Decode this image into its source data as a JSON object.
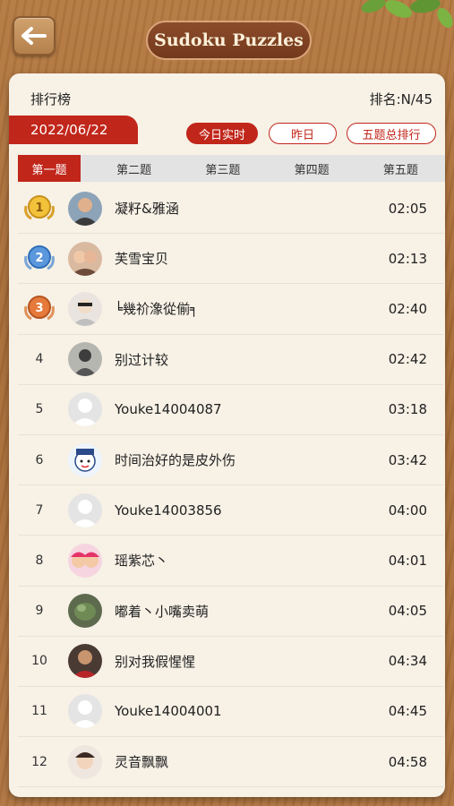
{
  "header": {
    "title": "Sudoku Puzzles"
  },
  "panel": {
    "board_title": "排行榜",
    "rank_info": "排名:N/45",
    "date": "2022/06/22",
    "filters": [
      "今日实时",
      "昨日",
      "五题总排行"
    ],
    "tabs": [
      "第一题",
      "第二题",
      "第三题",
      "第四题",
      "第五题"
    ]
  },
  "entries": [
    {
      "rank": "1",
      "name": "凝籽&雅涵",
      "time": "02:05"
    },
    {
      "rank": "2",
      "name": "芙雪宝贝",
      "time": "02:13"
    },
    {
      "rank": "3",
      "name": "╘幾祄潒從偂╕",
      "time": "02:40"
    },
    {
      "rank": "4",
      "name": "别过计较",
      "time": "02:42"
    },
    {
      "rank": "5",
      "name": "Youke14004087",
      "time": "03:18"
    },
    {
      "rank": "6",
      "name": "时间治好的是皮外伤",
      "time": "03:42"
    },
    {
      "rank": "7",
      "name": "Youke14003856",
      "time": "04:00"
    },
    {
      "rank": "8",
      "name": "瑶紫芯丶",
      "time": "04:01"
    },
    {
      "rank": "9",
      "name": "嘟着丶小嘴卖萌",
      "time": "04:05"
    },
    {
      "rank": "10",
      "name": "别对我假惺惺",
      "time": "04:34"
    },
    {
      "rank": "11",
      "name": "Youke14004001",
      "time": "04:45"
    },
    {
      "rank": "12",
      "name": "灵音飘飘",
      "time": "04:58"
    }
  ],
  "colors": {
    "accent": "#c1261a",
    "wood": "#b07540"
  }
}
